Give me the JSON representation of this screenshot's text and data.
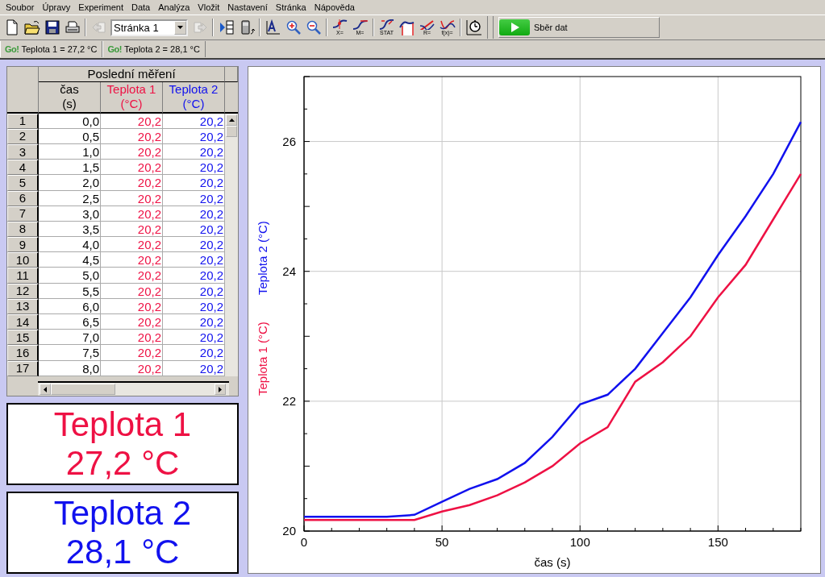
{
  "menu": [
    "Soubor",
    "Úpravy",
    "Experiment",
    "Data",
    "Analýza",
    "Vložit",
    "Nastavení",
    "Stránka",
    "Nápověda"
  ],
  "toolbar": {
    "items": [
      {
        "kind": "new",
        "disabled": false
      },
      {
        "kind": "open",
        "disabled": false
      },
      {
        "kind": "save",
        "disabled": false
      },
      {
        "kind": "print",
        "disabled": false
      },
      {
        "kind": "sep"
      },
      {
        "kind": "prev",
        "disabled": true
      },
      {
        "kind": "page",
        "value": "Stránka 1"
      },
      {
        "kind": "next",
        "disabled": true
      },
      {
        "kind": "sep"
      },
      {
        "kind": "table",
        "disabled": false
      },
      {
        "kind": "device",
        "disabled": false
      },
      {
        "kind": "sep"
      },
      {
        "kind": "autoscale",
        "disabled": false
      },
      {
        "kind": "zoomin",
        "disabled": false
      },
      {
        "kind": "zoomout",
        "disabled": false
      },
      {
        "kind": "sep"
      },
      {
        "kind": "examine",
        "caption": "X=",
        "disabled": false
      },
      {
        "kind": "tangent",
        "caption": "M=",
        "disabled": false
      },
      {
        "kind": "sep"
      },
      {
        "kind": "stats",
        "caption": "STAT",
        "disabled": false
      },
      {
        "kind": "integral",
        "disabled": false
      },
      {
        "kind": "linfit",
        "caption": "R=",
        "disabled": false
      },
      {
        "kind": "curvefit",
        "caption": "f(x)=",
        "disabled": false
      },
      {
        "kind": "sep"
      },
      {
        "kind": "timing",
        "disabled": false
      }
    ],
    "collect": "Sběr dat"
  },
  "sensors": [
    {
      "badge": "Go!",
      "text": "Teplota 1 = 27,2 °C"
    },
    {
      "badge": "Go!",
      "text": "Teplota 2 = 28,1 °C"
    }
  ],
  "table": {
    "title": "Poslední měření",
    "columns": [
      {
        "name": "čas",
        "unit": "(s)",
        "color": "#000000"
      },
      {
        "name": "Teplota 1",
        "unit": "(°C)",
        "color": "#ee1144"
      },
      {
        "name": "Teplota 2",
        "unit": "(°C)",
        "color": "#1111ee"
      }
    ],
    "rows": [
      {
        "label": "1",
        "cells": [
          "0,0",
          "20,2",
          "20,2"
        ]
      },
      {
        "label": "2",
        "cells": [
          "0,5",
          "20,2",
          "20,2"
        ]
      },
      {
        "label": "3",
        "cells": [
          "1,0",
          "20,2",
          "20,2"
        ]
      },
      {
        "label": "4",
        "cells": [
          "1,5",
          "20,2",
          "20,2"
        ]
      },
      {
        "label": "5",
        "cells": [
          "2,0",
          "20,2",
          "20,2"
        ]
      },
      {
        "label": "6",
        "cells": [
          "2,5",
          "20,2",
          "20,2"
        ]
      },
      {
        "label": "7",
        "cells": [
          "3,0",
          "20,2",
          "20,2"
        ]
      },
      {
        "label": "8",
        "cells": [
          "3,5",
          "20,2",
          "20,2"
        ]
      },
      {
        "label": "9",
        "cells": [
          "4,0",
          "20,2",
          "20,2"
        ]
      },
      {
        "label": "10",
        "cells": [
          "4,5",
          "20,2",
          "20,2"
        ]
      },
      {
        "label": "11",
        "cells": [
          "5,0",
          "20,2",
          "20,2"
        ]
      },
      {
        "label": "12",
        "cells": [
          "5,5",
          "20,2",
          "20,2"
        ]
      },
      {
        "label": "13",
        "cells": [
          "6,0",
          "20,2",
          "20,2"
        ]
      },
      {
        "label": "14",
        "cells": [
          "6,5",
          "20,2",
          "20,2"
        ]
      },
      {
        "label": "15",
        "cells": [
          "7,0",
          "20,2",
          "20,2"
        ]
      },
      {
        "label": "16",
        "cells": [
          "7,5",
          "20,2",
          "20,2"
        ]
      },
      {
        "label": "17",
        "cells": [
          "8,0",
          "20,2",
          "20,2"
        ]
      }
    ]
  },
  "meters": [
    {
      "name": "Teplota 1",
      "reading": "27,2 °C",
      "color": "#ee1144"
    },
    {
      "name": "Teplota 2",
      "reading": "28,1 °C",
      "color": "#1111ee"
    }
  ],
  "graph": {
    "chart_data": {
      "type": "line",
      "xlabel": "čas (s)",
      "x": [
        0,
        10,
        20,
        30,
        40,
        50,
        60,
        70,
        80,
        90,
        100,
        110,
        120,
        130,
        140,
        150,
        160,
        170,
        180
      ],
      "series": [
        {
          "name": "Teplota 1 (°C)",
          "color": "#ee1144",
          "values": [
            20.17,
            20.17,
            20.17,
            20.17,
            20.17,
            20.3,
            20.4,
            20.55,
            20.75,
            21.0,
            21.35,
            21.6,
            22.3,
            22.6,
            23.0,
            23.6,
            24.1,
            24.8,
            25.5
          ]
        },
        {
          "name": "Teplota 2 (°C)",
          "color": "#1111ee",
          "values": [
            20.22,
            20.22,
            20.22,
            20.22,
            20.25,
            20.45,
            20.65,
            20.8,
            21.05,
            21.45,
            21.95,
            22.1,
            22.5,
            23.05,
            23.6,
            24.25,
            24.85,
            25.5,
            26.3
          ]
        }
      ],
      "grid": true,
      "xlim": [
        0,
        180
      ],
      "ylim": [
        20,
        27
      ],
      "xticks": [
        0,
        50,
        100,
        150
      ],
      "yticks": [
        {
          "value": 20,
          "label": "20"
        },
        {
          "value": 22,
          "label": "22"
        },
        {
          "value": 24,
          "label": "24"
        },
        {
          "value": 26,
          "label": "26"
        }
      ]
    }
  }
}
